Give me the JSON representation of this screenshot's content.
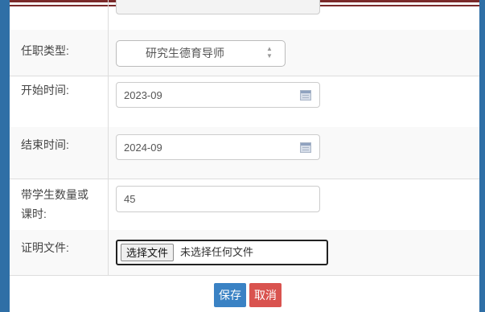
{
  "form": {
    "position_type": {
      "label": "任职类型:",
      "selected": "研究生德育导师"
    },
    "start_time": {
      "label": "开始时间:",
      "value": "2023-09"
    },
    "end_time": {
      "label": "结束时间:",
      "value": "2024-09"
    },
    "student_count": {
      "label_line1": "带学生数量或",
      "label_line2": "课时:",
      "value": "45"
    },
    "proof_file": {
      "label": "证明文件:",
      "button_label": "选择文件",
      "status": "未选择任何文件"
    }
  },
  "actions": {
    "save_label": "保存",
    "cancel_label": "取消"
  },
  "colors": {
    "frame": "#2f6fa6",
    "top_rule": "#7a2a2a",
    "save_button": "#3a82c4",
    "cancel_button": "#d9534f"
  }
}
